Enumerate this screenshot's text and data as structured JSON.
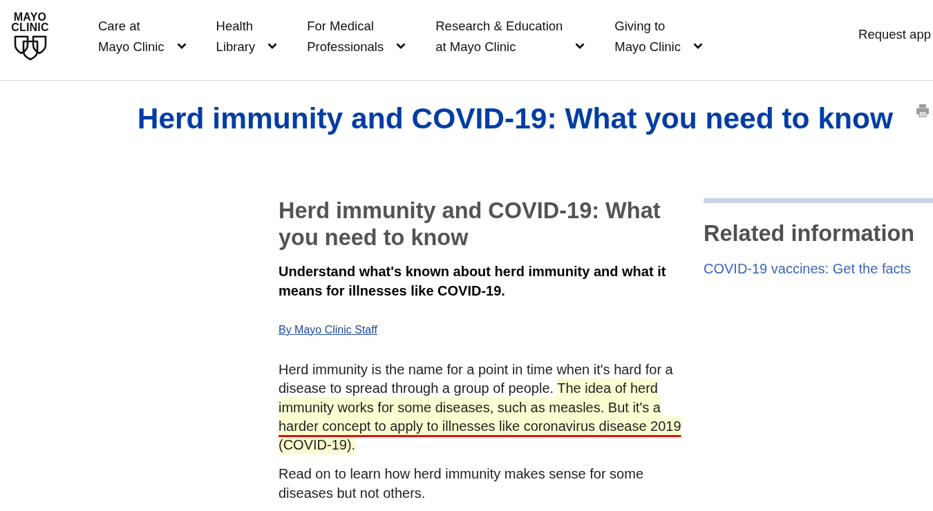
{
  "header": {
    "logo": {
      "lines": [
        "MAYO",
        "CLINIC"
      ]
    },
    "nav": [
      {
        "lines": [
          "Care at",
          "Mayo Clinic"
        ]
      },
      {
        "lines": [
          "Health",
          "Library"
        ]
      },
      {
        "lines": [
          "For Medical",
          "Professionals"
        ]
      },
      {
        "lines": [
          "Research & Education",
          "at Mayo Clinic"
        ]
      },
      {
        "lines": [
          "Giving to",
          "Mayo Clinic"
        ]
      }
    ],
    "request_link": "Request app"
  },
  "page_title": "Herd immunity and COVID-19: What you need to know",
  "article": {
    "headline": "Herd immunity and COVID-19: What you need to know",
    "subtitle": "Understand what's known about herd immunity and what it means for illnesses like COVID-19.",
    "byline": "By Mayo Clinic Staff",
    "paragraphs": [
      {
        "segments": [
          {
            "text": "Herd immunity is the name for a point in time when it's hard for a disease to spread through a group of people. ",
            "highlighted": false,
            "underlined": false
          },
          {
            "text": "The idea of herd immunity works for some diseases, such as measles. But it's a ",
            "highlighted": true,
            "underlined": false
          },
          {
            "text": "harder concept to apply to illnesses like coronavirus disease 2019",
            "highlighted": true,
            "underlined": true
          },
          {
            "text": " (COVID-19).",
            "highlighted": true,
            "underlined": false
          }
        ]
      },
      {
        "segments": [
          {
            "text": "Read on to learn how herd immunity makes sense for some diseases but not others.",
            "highlighted": false,
            "underlined": false
          }
        ]
      }
    ]
  },
  "related": {
    "title": "Related information",
    "links": [
      "COVID-19 vaccines: Get the facts"
    ]
  }
}
